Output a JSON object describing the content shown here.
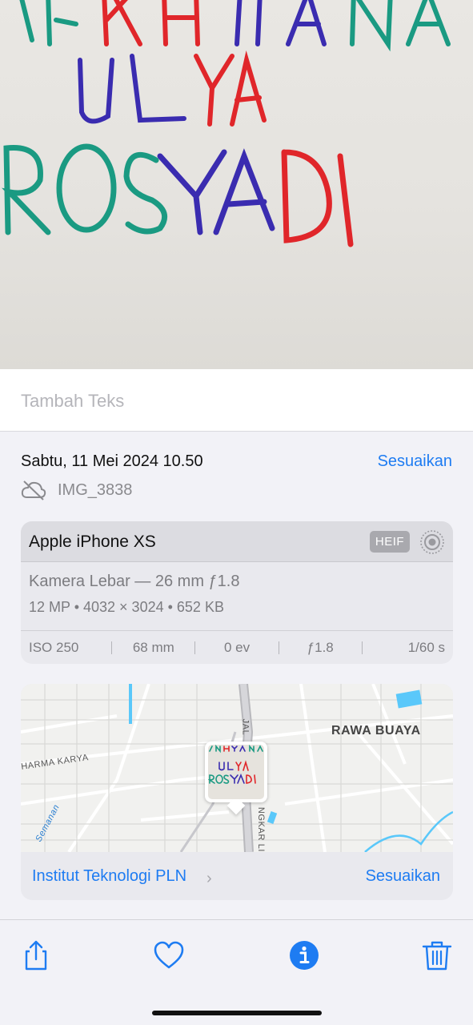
{
  "photo": {
    "lines": [
      "MAKHYANA",
      "ULYA",
      "ROSYADI"
    ],
    "colors": {
      "green": "#1a9a82",
      "blue": "#3a2cb0",
      "red": "#e0262a"
    }
  },
  "caption": {
    "placeholder": "Tambah Teks"
  },
  "info": {
    "date": "Sabtu, 11 Mei 2024 10.50",
    "adjust": "Sesuaikan",
    "filename": "IMG_3838"
  },
  "camera": {
    "device": "Apple iPhone XS",
    "format_badge": "HEIF",
    "lens": "Kamera Lebar — 26 mm ƒ1.8",
    "specs": "12 MP  •  4032 × 3024  •  652 KB",
    "exif": [
      "ISO 250",
      "68 mm",
      "0 ev",
      "ƒ1.8",
      "1/60 s"
    ]
  },
  "map": {
    "labels": {
      "district": "RAWA BUAYA",
      "street1": "HARMA KARYA",
      "street2": "Semanan",
      "street3": "JAL",
      "street4": "NGKAR LI"
    },
    "place": "Institut Teknologi PLN",
    "adjust": "Sesuaikan",
    "accent": "#1e7cf2"
  },
  "toolbar": {
    "icons": [
      "share-icon",
      "heart-icon",
      "info-icon",
      "trash-icon"
    ],
    "accent": "#1e7cf2"
  }
}
